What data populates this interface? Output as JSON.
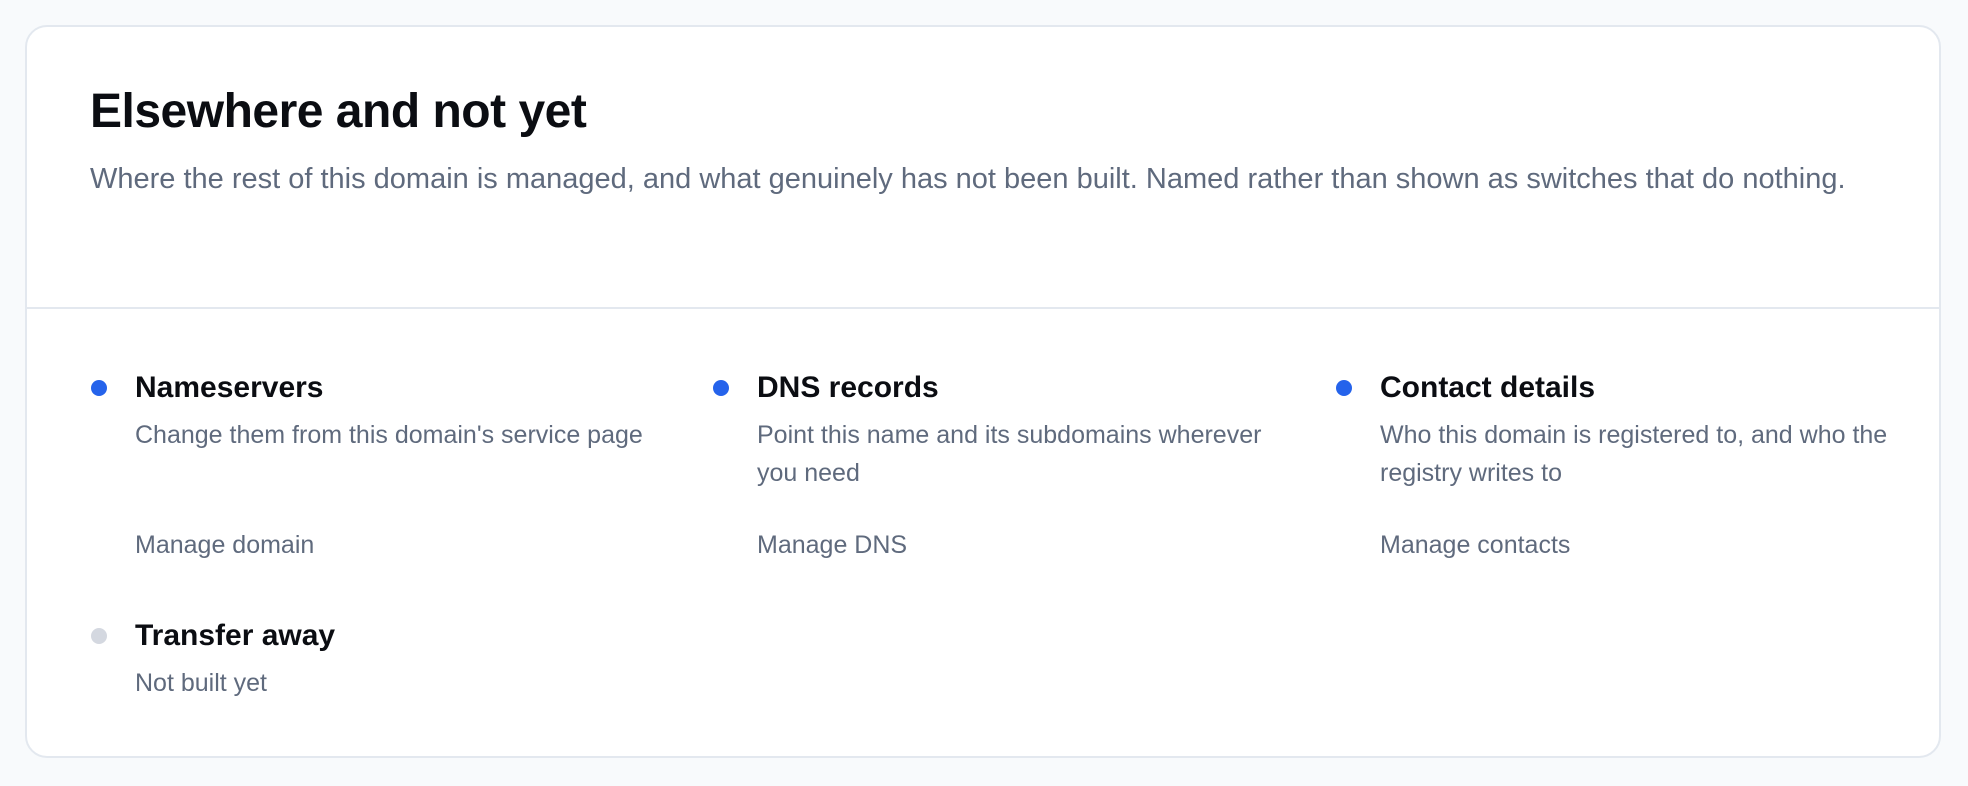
{
  "panel": {
    "title": "Elsewhere and not yet",
    "subtitle": "Where the rest of this domain is managed, and what genuinely has not been built. Named rather than shown as switches that do nothing."
  },
  "items": [
    {
      "title": "Nameservers",
      "description": "Change them from this domain's service page",
      "link": "Manage domain",
      "status": "available"
    },
    {
      "title": "DNS records",
      "description": "Point this name and its subdomains wherever you need",
      "link": "Manage DNS",
      "status": "available"
    },
    {
      "title": "Contact details",
      "description": "Who this domain is registered to, and who the registry writes to",
      "link": "Manage contacts",
      "status": "available"
    },
    {
      "title": "Transfer away",
      "description": "Not built yet",
      "status": "not-built"
    }
  ],
  "colors": {
    "accent": "#2563eb",
    "inactive_dot": "#d4d8e0",
    "muted_text": "#5f6a7d",
    "heading_text": "#0b0d12",
    "border": "#e3e8ef"
  }
}
